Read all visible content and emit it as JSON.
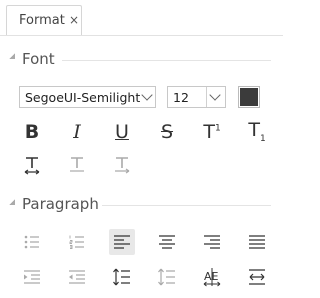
{
  "tab": {
    "label": "Format",
    "close": "×"
  },
  "font_section": {
    "title": "Font",
    "font_family": "SegoeUI-Semilight",
    "font_size": "12",
    "color": "#3b3b3b"
  },
  "paragraph_section": {
    "title": "Paragraph"
  },
  "icons": {
    "bold": "B",
    "italic": "I",
    "underline": "U",
    "strike": "S",
    "superscript": "T",
    "superscript_mark": "1",
    "subscript": "T",
    "subscript_mark": "1"
  }
}
